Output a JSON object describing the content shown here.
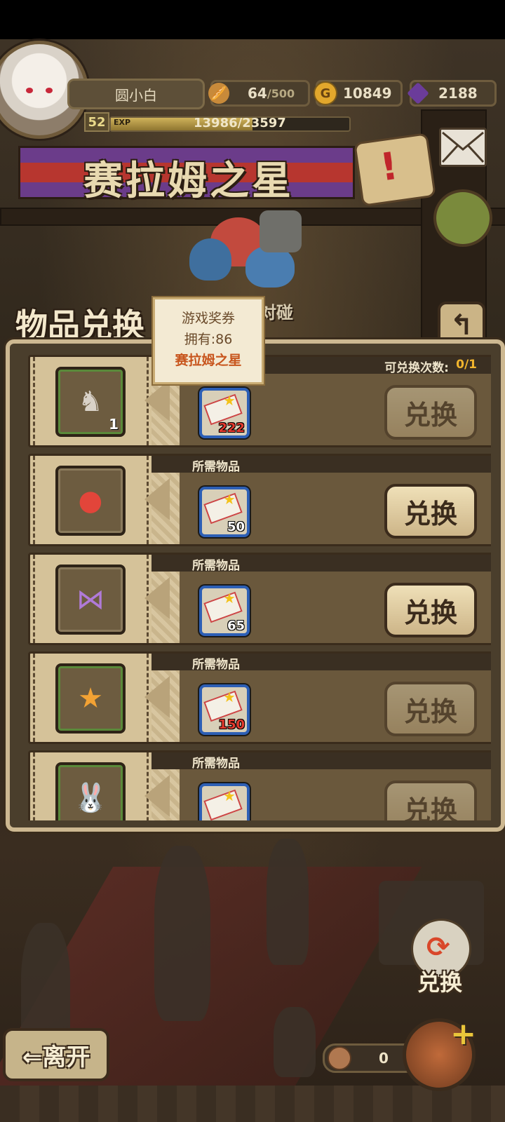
{
  "hud": {
    "player_name": "圆小白",
    "level": "52",
    "exp_label": "EXP",
    "exp_text": "13986/23597",
    "exp_fraction": 0.593,
    "bread": "64",
    "bread_max": "/500",
    "gold": "10849",
    "gems": "2188"
  },
  "banner_title": "赛拉姆之星",
  "panel_title": "物品兑换",
  "bg_text": "对碰",
  "tooltip": {
    "line1": "游戏奖券",
    "line2": "拥有:86",
    "line3": "赛拉姆之星"
  },
  "rows": [
    {
      "header": "",
      "count_label": "可兑换次数:",
      "count_value": "0/1",
      "item_icon": "knight-figurine-icon",
      "item_qty": "1",
      "cost": "222",
      "cost_insufficient": true,
      "button": "兑换",
      "enabled": false
    },
    {
      "header": "所需物品",
      "item_icon": "red-orb-icon",
      "item_qty": "",
      "cost": "50",
      "cost_insufficient": false,
      "button": "兑换",
      "enabled": true
    },
    {
      "header": "所需物品",
      "item_icon": "rainbow-bow-icon",
      "item_qty": "",
      "cost": "65",
      "cost_insufficient": false,
      "button": "兑换",
      "enabled": true
    },
    {
      "header": "所需物品",
      "item_icon": "stars-icon",
      "item_qty": "",
      "cost": "150",
      "cost_insufficient": true,
      "button": "兑换",
      "enabled": false
    },
    {
      "header": "所需物品",
      "item_icon": "bunny-icon",
      "item_qty": "",
      "cost": "",
      "cost_insufficient": false,
      "button": "兑换",
      "enabled": false
    }
  ],
  "bottom": {
    "leave_label": "⇐离开",
    "exchange_label": "兑换",
    "coin_count": "0"
  },
  "colors": {
    "accent": "#f2b52d",
    "panel": "#4a3e2c",
    "insufficient": "#e53a2e"
  }
}
